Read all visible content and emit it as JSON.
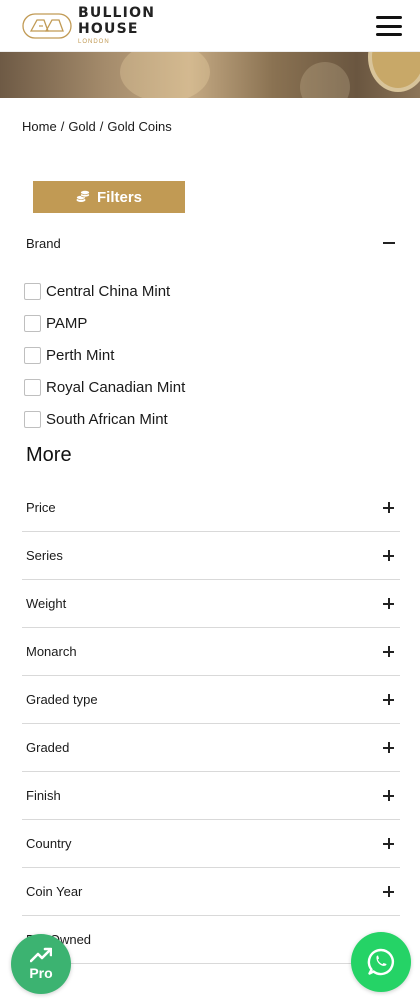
{
  "header": {
    "logo_line1": "BULLION",
    "logo_line2": "HOUSE",
    "logo_sub": "LONDON",
    "menu_icon": "hamburger-icon"
  },
  "breadcrumb": {
    "items": [
      "Home",
      "Gold",
      "Gold Coins"
    ],
    "separator": "/"
  },
  "filters_button": {
    "label": "Filters",
    "icon": "coins-stack-icon",
    "color": "#c19a54"
  },
  "brand": {
    "title": "Brand",
    "items": [
      "Central China Mint",
      "PAMP",
      "Perth Mint",
      "Royal Canadian Mint",
      "South African Mint"
    ]
  },
  "more": {
    "title": "More",
    "items": [
      "Price",
      "Series",
      "Weight",
      "Monarch",
      "Graded type",
      "Graded",
      "Finish",
      "Country",
      "Coin Year",
      "Pre Owned"
    ]
  },
  "floating": {
    "pro_label": "Pro",
    "pro_color": "#3cb371",
    "whatsapp_color": "#25d366"
  }
}
